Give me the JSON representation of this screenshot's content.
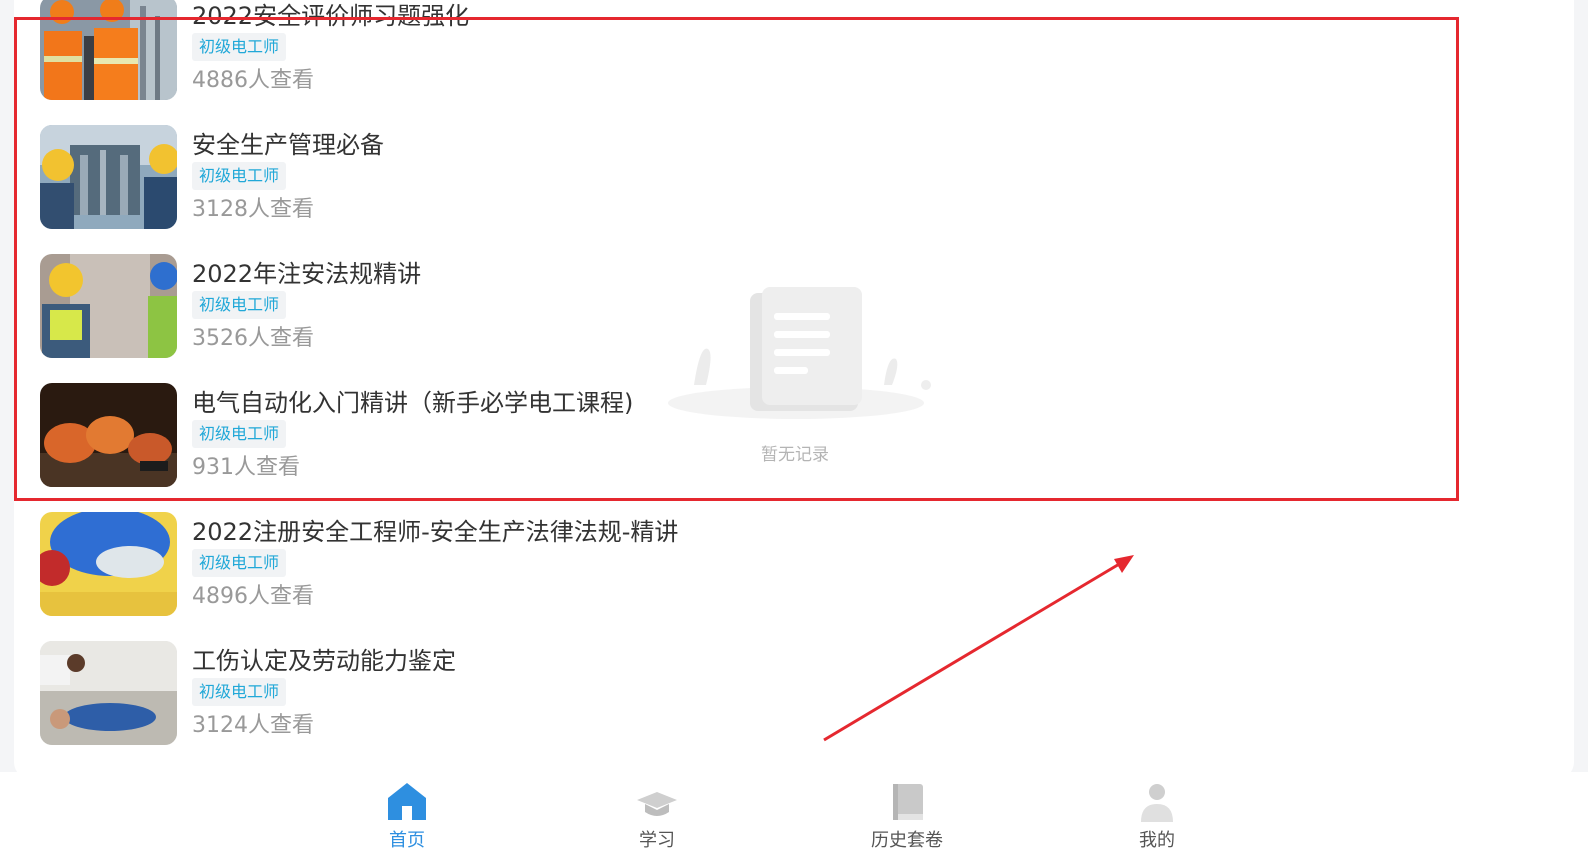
{
  "courses": [
    {
      "title": "2022安全评价师习题强化",
      "tag": "初级电工师",
      "views": "4886人查看"
    },
    {
      "title": "安全生产管理必备",
      "tag": "初级电工师",
      "views": "3128人查看"
    },
    {
      "title": "2022年注安法规精讲",
      "tag": "初级电工师",
      "views": "3526人查看"
    },
    {
      "title": "电气自动化入门精讲（新手必学电工课程)",
      "tag": "初级电工师",
      "views": "931人查看"
    },
    {
      "title": "2022注册安全工程师-安全生产法律法规-精讲",
      "tag": "初级电工师",
      "views": "4896人查看"
    },
    {
      "title": "工伤认定及劳动能力鉴定",
      "tag": "初级电工师",
      "views": "3124人查看"
    }
  ],
  "empty_state": {
    "text": "暂无记录",
    "icon": "document-scroll-icon"
  },
  "nav": {
    "items": [
      {
        "label": "首页",
        "icon": "home-icon",
        "active": true
      },
      {
        "label": "学习",
        "icon": "graduation-cap-icon",
        "active": false
      },
      {
        "label": "历史套卷",
        "icon": "book-icon",
        "active": false
      },
      {
        "label": "我的",
        "icon": "user-icon",
        "active": false
      }
    ]
  },
  "colors": {
    "accent": "#2e8fe0",
    "tag_text": "#21a8d8",
    "annotation_red": "#e5282f"
  }
}
